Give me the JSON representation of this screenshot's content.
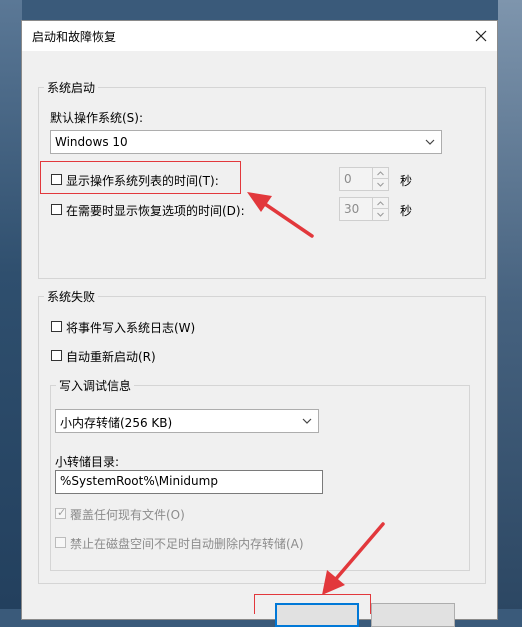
{
  "dialog": {
    "title": "启动和故障恢复"
  },
  "icons": {
    "close": "close-icon",
    "dropdown": "chevron-down-icon",
    "spin_up": "arrow-up-icon",
    "spin_down": "arrow-down-icon",
    "check": "check-icon"
  },
  "colors": {
    "annotation_red": "#e2383c",
    "focus_blue": "#0078d7"
  },
  "system_startup": {
    "legend": "系统启动",
    "default_os_label": "默认操作系统(S):",
    "default_os_value": "Windows 10",
    "show_os_list_label": "显示操作系统列表的时间(T):",
    "show_os_list_checked": false,
    "show_os_list_value": "0",
    "show_os_list_unit": "秒",
    "show_recovery_label": "在需要时显示恢复选项的时间(D):",
    "show_recovery_checked": false,
    "show_recovery_value": "30",
    "show_recovery_unit": "秒"
  },
  "system_failure": {
    "legend": "系统失败",
    "write_event_label": "将事件写入系统日志(W)",
    "write_event_checked": false,
    "auto_restart_label": "自动重新启动(R)",
    "auto_restart_checked": false,
    "debug_info": {
      "legend": "写入调试信息",
      "dump_type_value": "小内存转储(256 KB)",
      "dump_dir_label": "小转储目录:",
      "dump_dir_value": "%SystemRoot%\\Minidump",
      "overwrite_label": "覆盖任何现有文件(O)",
      "overwrite_checked": true,
      "disable_auto_delete_label": "禁止在磁盘空间不足时自动删除内存转储(A)",
      "disable_auto_delete_checked": false
    }
  }
}
